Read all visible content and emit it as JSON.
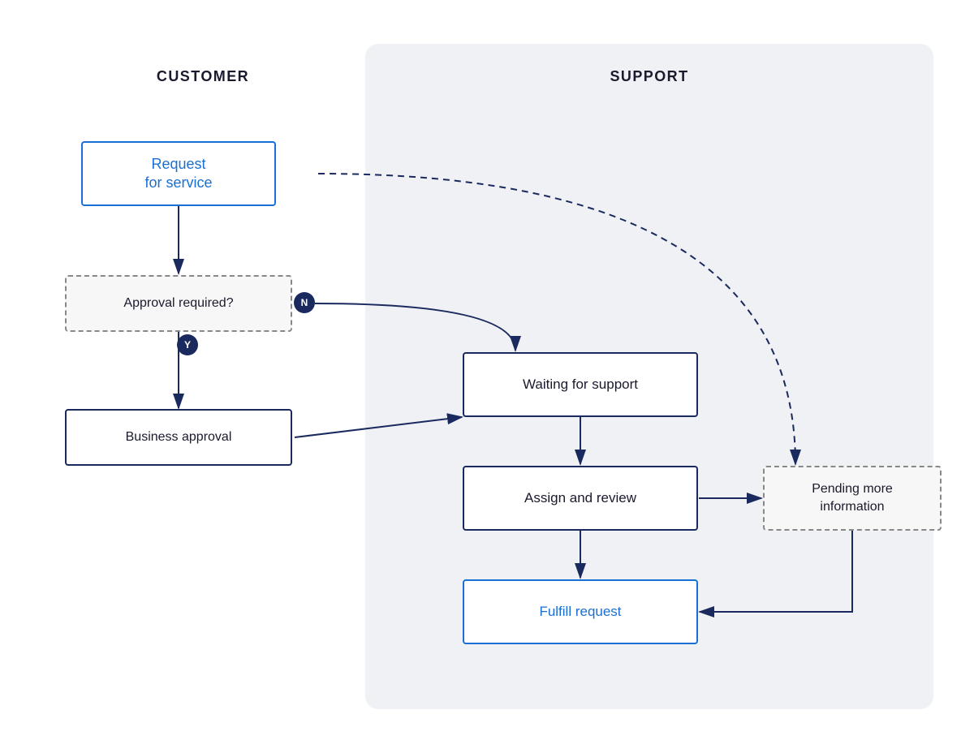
{
  "diagram": {
    "customer_title": "CUSTOMER",
    "support_title": "SUPPORT",
    "nodes": {
      "request_service": "Request\nfor service",
      "approval_required": "Approval required?",
      "business_approval": "Business approval",
      "waiting_support": "Waiting for support",
      "assign_review": "Assign and review",
      "fulfill_request": "Fulfill request",
      "pending_info": "Pending more\ninformation"
    },
    "badges": {
      "n": "N",
      "y": "Y"
    }
  }
}
